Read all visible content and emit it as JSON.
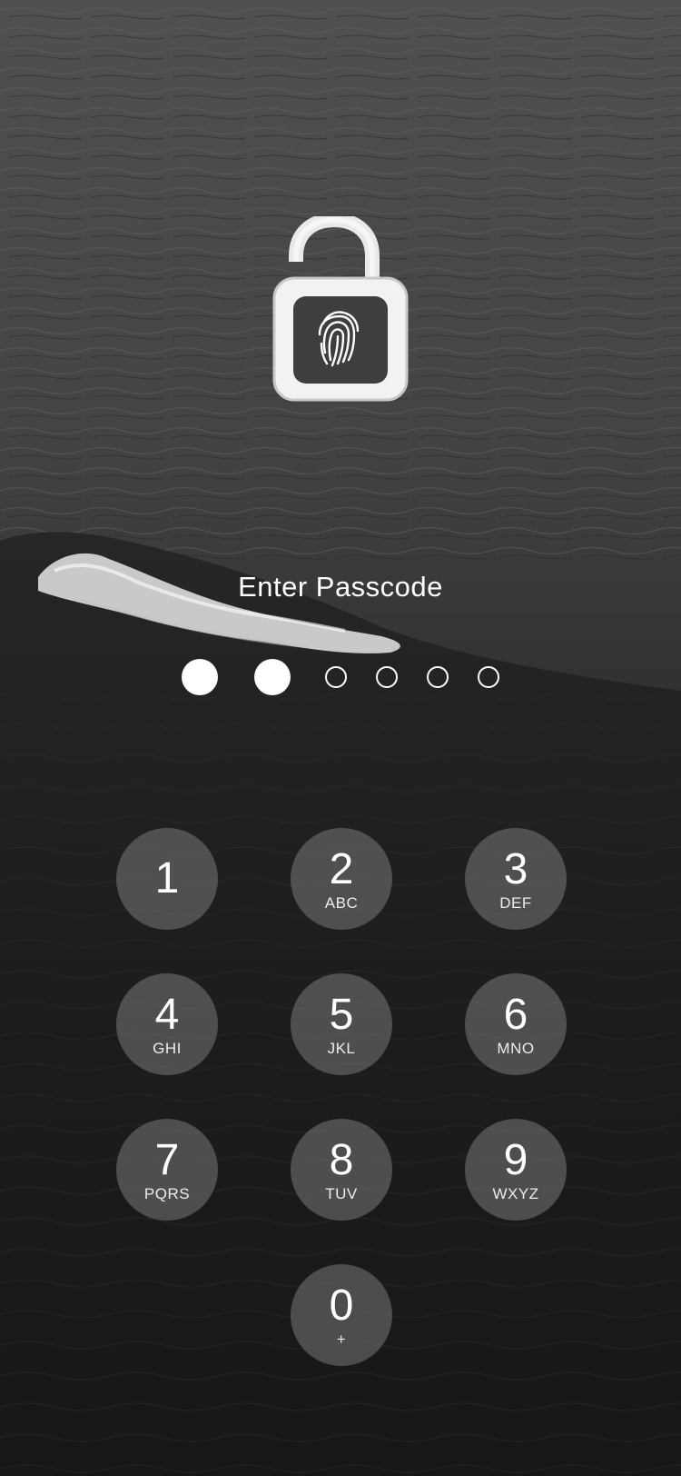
{
  "lock_screen": {
    "prompt": "Enter Passcode",
    "passcode_length": 6,
    "entered_count": 2
  },
  "keypad": {
    "keys": [
      {
        "digit": "1",
        "letters": ""
      },
      {
        "digit": "2",
        "letters": "ABC"
      },
      {
        "digit": "3",
        "letters": "DEF"
      },
      {
        "digit": "4",
        "letters": "GHI"
      },
      {
        "digit": "5",
        "letters": "JKL"
      },
      {
        "digit": "6",
        "letters": "MNO"
      },
      {
        "digit": "7",
        "letters": "PQRS"
      },
      {
        "digit": "8",
        "letters": "TUV"
      },
      {
        "digit": "9",
        "letters": "WXYZ"
      },
      {
        "digit": "0",
        "letters": "+"
      }
    ]
  },
  "icons": {
    "lock": "padlock-open-fingerprint-icon"
  },
  "colors": {
    "text": "#ffffff",
    "key_fill": "#787878"
  }
}
